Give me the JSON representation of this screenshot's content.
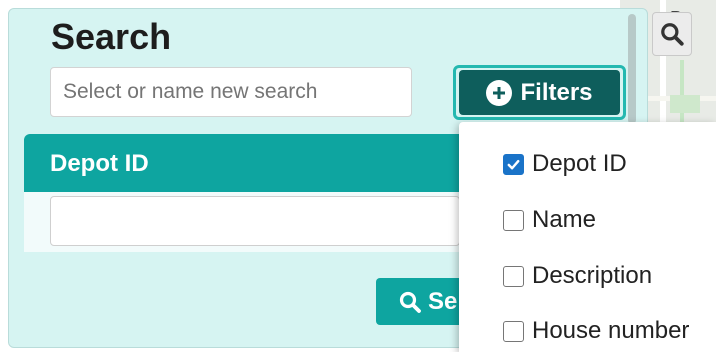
{
  "map": {
    "label": "Pa"
  },
  "panel": {
    "title": "Search",
    "search_input": {
      "value": "",
      "placeholder": "Select or name new search"
    },
    "filters_button": {
      "label": "Filters",
      "icon": "plus-circle-icon"
    },
    "depot_field": {
      "header": "Depot ID",
      "value": ""
    },
    "search_button": {
      "label": "Se",
      "icon": "search-icon"
    }
  },
  "dropdown": {
    "items": [
      {
        "label": "Depot ID",
        "checked": true
      },
      {
        "label": "Name",
        "checked": false
      },
      {
        "label": "Description",
        "checked": false
      },
      {
        "label": "House number",
        "checked": false
      }
    ]
  },
  "colors": {
    "panel_bg": "#d6f4f2",
    "accent": "#0ea5a0",
    "filters_bg": "#0e5e5c",
    "checkbox_checked": "#1a73c8"
  }
}
